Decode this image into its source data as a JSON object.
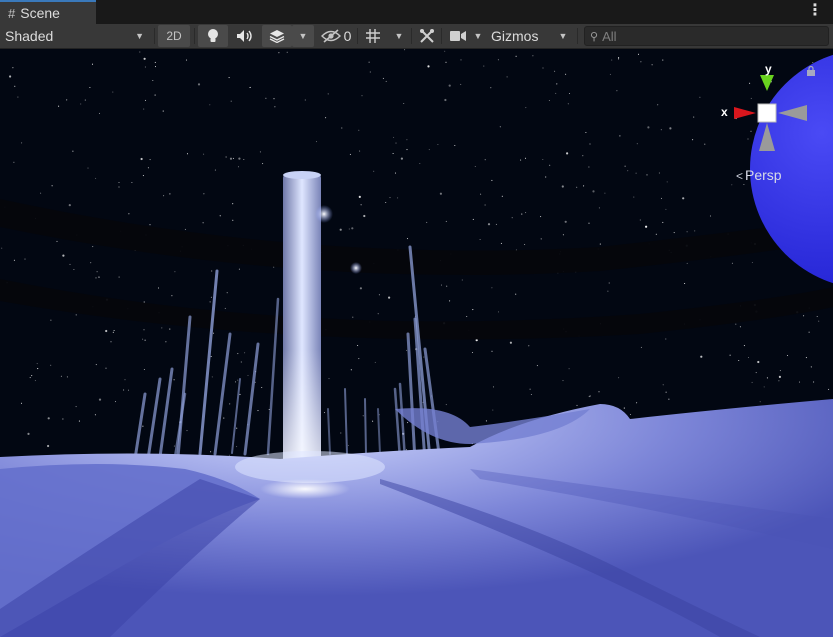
{
  "tab": {
    "icon": "#",
    "label": "Scene",
    "menu_glyph": "⋮"
  },
  "toolbar": {
    "shading_mode": "Shaded",
    "toggle_2d": "2D",
    "hidden_count": "0",
    "gizmos_label": "Gizmos",
    "search_placeholder": "All",
    "icons": [
      "lightbulb-icon",
      "audio-icon",
      "effects-layers-icon",
      "scene-visibility-icon",
      "grid-icon",
      "tools-icon",
      "camera-icon"
    ]
  },
  "gizmo": {
    "x_label": "x",
    "y_label": "y",
    "projection": "Persp",
    "colors": {
      "x_axis": "#d9161d",
      "y_axis": "#69d21f",
      "neutral_cone": "#9a9a9a"
    }
  },
  "scene": {
    "sky_color": "#020712",
    "ground_color": "#5a63c8",
    "planet_color": "#2d2dea",
    "tower_light_color": "#e8f0ff"
  },
  "colors": {
    "tab_accent": "#3a79bb",
    "toolbar_bg": "#383838",
    "window_bg": "#191919"
  }
}
